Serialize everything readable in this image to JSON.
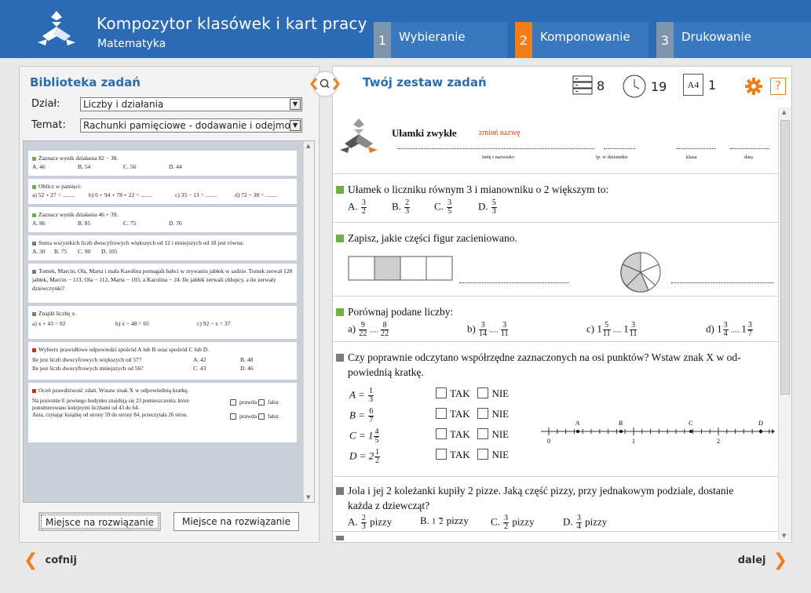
{
  "header": {
    "title": "Kompozytor klasówek i kart pracy",
    "subtitle": "Matematyka",
    "steps": [
      {
        "num": "1",
        "label": "Wybieranie"
      },
      {
        "num": "2",
        "label": "Komponowanie"
      },
      {
        "num": "3",
        "label": "Drukowanie"
      }
    ],
    "colors": {
      "bar": "#2c6bb3",
      "active": "#f07e1a"
    }
  },
  "library": {
    "title": "Biblioteka zadań",
    "dzial_label": "Dział:",
    "dzial_value": "Liczby i działania",
    "temat_label": "Temat:",
    "temat_value": "Rachunki pamięciowe - dodawanie i odejmo",
    "cards": [
      {
        "q": "Zaznacz wynik działania 82 − 38.",
        "a": [
          "A. 46",
          "B. 54",
          "C. 56",
          "D. 44"
        ]
      },
      {
        "q": "Oblicz w pamięci:",
        "a": [
          "a) 52 + 27 = ........",
          "b) 6 + 94 + 78 + 22 = ........",
          "c) 35 − 13 = ........",
          "d) 72 − 38 = ........"
        ]
      },
      {
        "q": "Zaznacz wynik działania 46 + 39.",
        "a": [
          "A. 86",
          "B. 85",
          "C. 75",
          "D. 76"
        ]
      },
      {
        "q": "Suma wszystkich liczb dwucyfrowych większych od 12 i mniejszych od 18 jest równa:",
        "a": [
          "A. 30",
          "B. 75",
          "C. 90",
          "D. 105"
        ]
      },
      {
        "q": "Tomek, Marcin, Ola, Marta i mała Karolina pomagali babci w zrywaniu jabłek w sadzie. Tomek zerwał 128 jabłek, Marcin − 113, Ola − 112, Marta − 103, a Karolina − 24. Ile jabłek zerwali chłopcy, a ile zerwały dziewczynki?"
      },
      {
        "q": "Znajdź liczbę x.",
        "a": [
          "a) x + 43 = 92",
          "b) x − 48 = 65",
          "c) 92 − x = 37"
        ]
      },
      {
        "q": "Wybierz prawidłowe odpowiedzi spośród A lub B oraz spośród C lub D.",
        "r1": [
          "Ile jest liczb dwucyfrowych większych od 57?",
          "A. 42",
          "B. 48"
        ],
        "r2": [
          "Ile jest liczb dwucyfrowych mniejszych od 56?",
          "C. 43",
          "D. 46"
        ]
      },
      {
        "q": "Oceń prawdziwość zdań. Wstaw znak X w odpowiednią kratkę.",
        "s1": "Na poziomie E pewnego budynku znajdują się 23 pomieszczenia, które ponumerowano kolejnymi liczbami od 43 do 64.",
        "s2": "Ania, czytając książkę od strony 59 do strony 84, przeczytała 26 stron.",
        "t": "prawda",
        "f": "fałsz"
      }
    ],
    "btn1": "Miejsce na rozwiązanie",
    "btn2": "Miejsce na rozwiązanie"
  },
  "set": {
    "title": "Twój zestaw zadań",
    "count": "8",
    "time": "19",
    "page_label": "A4",
    "pages": "1",
    "help": "?",
    "sheet": {
      "title": "Ułamki zwykłe",
      "rename": "zmień nazwę",
      "fields": [
        "imię i nazwisko",
        "lp. w dzienniku",
        "klasa",
        "data"
      ]
    },
    "q1": {
      "text": "Ułamek o liczniku równym 3 i mianowniku o 2 większym to:",
      "opts": [
        {
          "l": "A.",
          "n": "3",
          "d": "2"
        },
        {
          "l": "B.",
          "n": "2",
          "d": "3"
        },
        {
          "l": "C.",
          "n": "3",
          "d": "5"
        },
        {
          "l": "D.",
          "n": "5",
          "d": "3"
        }
      ]
    },
    "q2": {
      "text": "Zapisz, jakie części figur zacieniowano."
    },
    "q3": {
      "text": "Porównaj podane liczby:",
      "a": "a)",
      "b": "b)",
      "c": "c)",
      "d": "d)"
    },
    "q4": {
      "text1": "Czy poprawnie odczytano współrzędne zaznaczonych na osi punktów? Wstaw znak X w od-",
      "text2": "powiednią kratkę.",
      "tak": "TAK",
      "nie": "NIE",
      "pts": [
        "A",
        "B",
        "C",
        "D"
      ],
      "axis": [
        "0",
        "1",
        "2"
      ]
    },
    "q5": {
      "text1": "Jola i jej 2 koleżanki kupiły 2 pizze. Jaką część pizzy, przy jednakowym podziale, dostanie",
      "text2": "każda z dziewcząt?",
      "unit": "pizzy",
      "opts": [
        {
          "l": "A.",
          "n": "2",
          "d": "3"
        },
        {
          "l": "B.",
          "w": "1",
          "d": "2"
        },
        {
          "l": "C.",
          "n": "3",
          "d": "2"
        },
        {
          "l": "D.",
          "n": "3",
          "d": "4"
        }
      ]
    }
  },
  "footer": {
    "back": "cofnij",
    "next": "dalej"
  }
}
